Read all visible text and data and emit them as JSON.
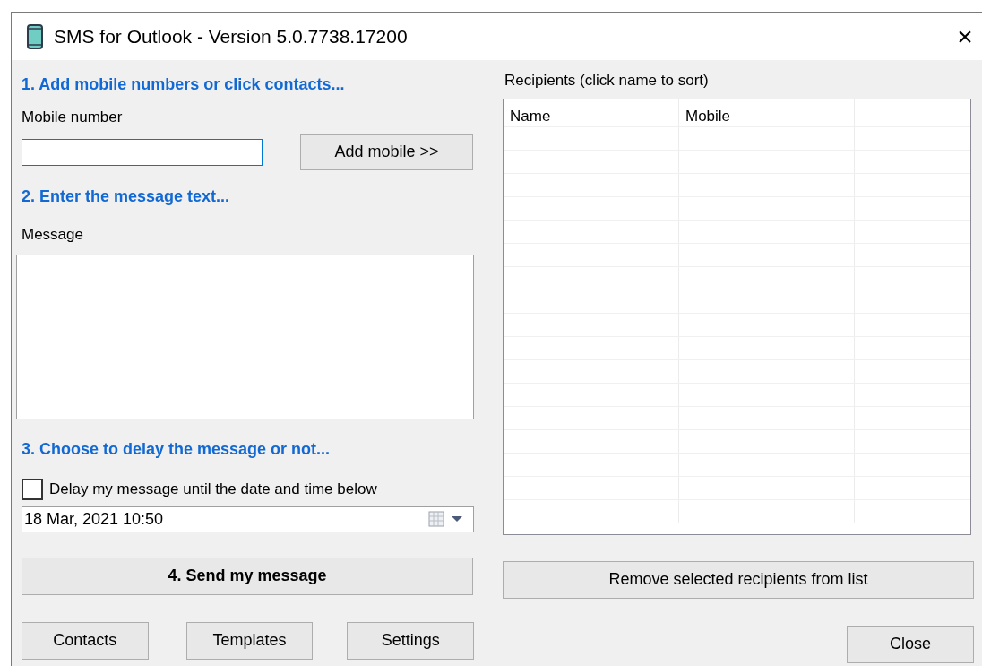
{
  "window": {
    "title": "SMS for Outlook - Version 5.0.7738.17200",
    "close": "×"
  },
  "left": {
    "step1": "1. Add mobile numbers or click contacts...",
    "mobile_label": "Mobile number",
    "add_button": "Add mobile >>",
    "step2": "2. Enter the message text...",
    "message_label": "Message",
    "step3": "3. Choose to delay the message or not...",
    "delay": {
      "label": "Delay my message until the date and time below",
      "checked": false
    },
    "date_value": "18 Mar, 2021 10:50",
    "send_button": "4. Send my message"
  },
  "recipients": {
    "label": "Recipients (click name to sort)",
    "columns": [
      "Name",
      "Mobile"
    ],
    "remove_button": "Remove selected recipients from list"
  },
  "bottom_buttons": [
    "Contacts",
    "Templates",
    "Settings"
  ],
  "close_button": "Close"
}
